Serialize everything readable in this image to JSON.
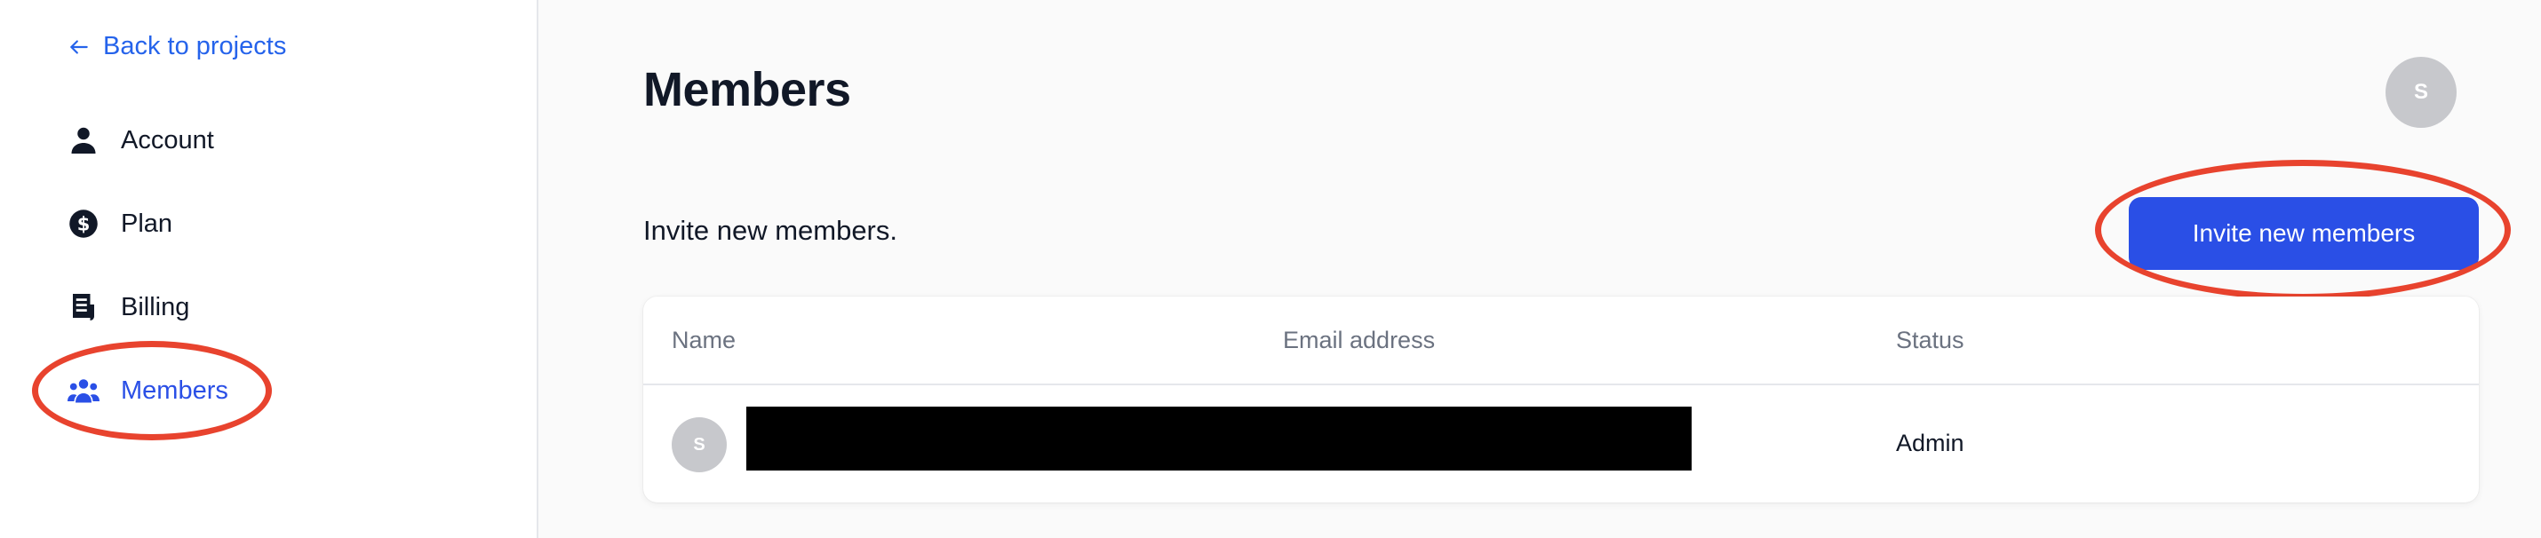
{
  "sidebar": {
    "back_label": "Back to projects",
    "items": [
      {
        "label": "Account",
        "icon": "user-icon"
      },
      {
        "label": "Plan",
        "icon": "dollar-icon"
      },
      {
        "label": "Billing",
        "icon": "receipt-icon"
      },
      {
        "label": "Members",
        "icon": "members-icon",
        "active": true
      }
    ]
  },
  "header": {
    "title": "Members",
    "avatar_initial": "S"
  },
  "invite": {
    "text": "Invite new members.",
    "button_label": "Invite new members"
  },
  "table": {
    "columns": [
      "Name",
      "Email address",
      "Status"
    ],
    "rows": [
      {
        "avatar_initial": "S",
        "status": "Admin"
      }
    ]
  },
  "colors": {
    "accent": "#2a4fe6",
    "annotation": "#e8432e",
    "avatar_bg": "#c7c8cc"
  }
}
